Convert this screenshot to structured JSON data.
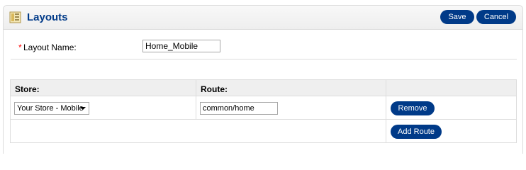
{
  "heading": {
    "title": "Layouts",
    "save_label": "Save",
    "cancel_label": "Cancel"
  },
  "form": {
    "required_marker": "*",
    "layout_name_label": "Layout Name:",
    "layout_name_value": "Home_Mobile"
  },
  "routes_table": {
    "columns": [
      "Store:",
      "Route:",
      ""
    ],
    "rows": [
      {
        "store": "Your Store - Mobile",
        "route": "common/home",
        "remove_label": "Remove"
      }
    ],
    "add_route_label": "Add Route"
  },
  "colors": {
    "accent": "#003a88",
    "required": "#ff0000",
    "header_bg": "#efefef"
  }
}
